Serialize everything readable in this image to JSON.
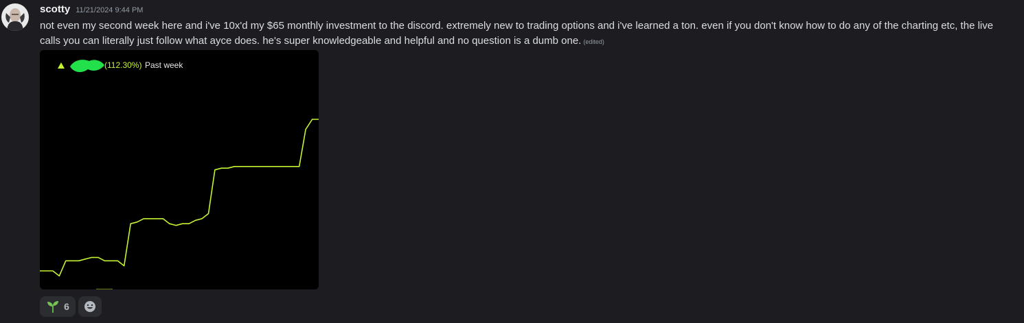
{
  "message": {
    "author": "scotty",
    "timestamp": "11/21/2024 9:44 PM",
    "text": "not even my second week here and i've 10x'd my $65 monthly investment to the discord. extremely new to trading options and i've learned a ton. even if you don't know how to do any of the charting etc, the live calls you can literally just follow what ayce does. he's super knowledgeable and helpful and no question is a dumb one.",
    "edited_label": "(edited)"
  },
  "attachment": {
    "change_percent": "(112.30%)",
    "period_label": "Past week",
    "colors": {
      "line": "#c6f432",
      "background": "#000000",
      "redaction": "#22e04a"
    }
  },
  "reactions": [
    {
      "emoji": "seedling-icon",
      "count": "6"
    }
  ],
  "chart_data": {
    "type": "line",
    "title": "",
    "xlabel": "",
    "ylabel": "",
    "change_percent": 112.3,
    "period": "Past week",
    "color": "#c6f432",
    "x": [
      0,
      1,
      2,
      3,
      4,
      5,
      6,
      7,
      8,
      9,
      10,
      11,
      12,
      13,
      14,
      15,
      16,
      17,
      18,
      19,
      20,
      21,
      22,
      23,
      24,
      25,
      26,
      27,
      28,
      29,
      30,
      31,
      32,
      33,
      34,
      35,
      36,
      37,
      38,
      39,
      40,
      41,
      42,
      43
    ],
    "values": [
      1.0,
      1.0,
      1.0,
      0.97,
      1.06,
      1.06,
      1.06,
      1.07,
      1.08,
      1.08,
      1.06,
      1.06,
      1.06,
      1.03,
      1.28,
      1.29,
      1.31,
      1.31,
      1.31,
      1.31,
      1.28,
      1.27,
      1.28,
      1.28,
      1.3,
      1.31,
      1.34,
      1.6,
      1.61,
      1.61,
      1.62,
      1.62,
      1.62,
      1.62,
      1.62,
      1.62,
      1.62,
      1.62,
      1.62,
      1.62,
      1.62,
      1.84,
      1.9,
      1.9
    ]
  }
}
